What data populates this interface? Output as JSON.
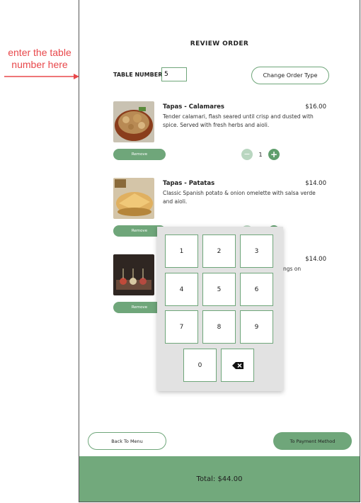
{
  "annotation": {
    "line1": "enter the table",
    "line2": "number here"
  },
  "header": {
    "title": "REVIEW ORDER"
  },
  "table": {
    "label": "TABLE NUMBER",
    "value": "5"
  },
  "order_type_label": "Change Order Type",
  "items": [
    {
      "name": "Tapas - Calamares",
      "price": "$16.00",
      "description": "Tender calamari, flash seared until crisp and dusted with spice. Served with fresh herbs and aioli.",
      "remove_label": "Remove",
      "quantity": "1"
    },
    {
      "name": "Tapas - Patatas",
      "price": "$14.00",
      "description": "Classic Spanish potato & onion omelette with salsa verde and aioli.",
      "remove_label": "Remove"
    },
    {
      "price": "$14.00",
      "description_partial": "ngs on",
      "remove_label": "Remove"
    }
  ],
  "stepper": {
    "minus": "−",
    "plus": "+"
  },
  "keypad": {
    "keys": [
      "1",
      "2",
      "3",
      "4",
      "5",
      "6",
      "7",
      "8",
      "9",
      "0"
    ]
  },
  "nav": {
    "back_label": "Back To Menu",
    "pay_label": "To Payment Method"
  },
  "footer": {
    "total": "Total: $44.00"
  },
  "colors": {
    "accent": "#6fa67a",
    "footer": "#72a97c",
    "annotation": "#e8484b"
  }
}
